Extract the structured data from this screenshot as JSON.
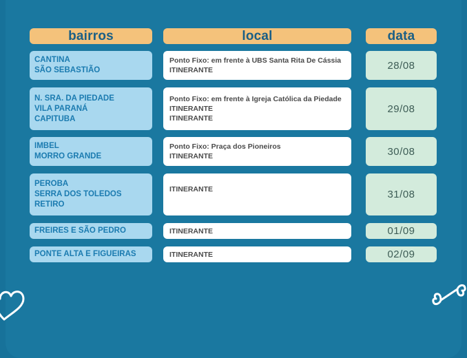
{
  "headers": {
    "bairros": "bairros",
    "local": "local",
    "data": "data"
  },
  "rows": [
    {
      "bairros": [
        "CANTINA",
        "SÃO SEBASTIÃO"
      ],
      "local": [
        "Ponto Fixo: em frente à UBS Santa Rita De Cássia",
        "ITINERANTE"
      ],
      "data": "28/08"
    },
    {
      "bairros": [
        "N. SRA. DA PIEDADE",
        "VILA PARANÁ",
        "CAPITUBA"
      ],
      "local": [
        "Ponto Fixo: em frente à Igreja Católica da Piedade",
        "ITINERANTE",
        "ITINERANTE"
      ],
      "data": "29/08"
    },
    {
      "bairros": [
        "IMBEL",
        "MORRO GRANDE"
      ],
      "local": [
        "Ponto Fixo: Praça dos Pioneiros",
        "ITINERANTE"
      ],
      "data": "30/08"
    },
    {
      "bairros": [
        "PEROBA",
        "SERRA DOS TOLEDOS",
        "RETIRO"
      ],
      "local": [
        "ITINERANTE"
      ],
      "data": "31/08"
    },
    {
      "bairros": [
        "FREIRES E SÃO PEDRO"
      ],
      "local": [
        "ITINERANTE"
      ],
      "data": "01/09"
    },
    {
      "bairros": [
        "PONTE ALTA E FIGUEIRAS"
      ],
      "local": [
        "ITINERANTE"
      ],
      "data": "02/09"
    }
  ],
  "icons": {
    "left": "heart-icon",
    "right": "bone-icon"
  },
  "colors": {
    "background": "#17729a",
    "header": "#f4c27b",
    "bairro_cell": "#a9d8ef",
    "local_cell": "#ffffff",
    "data_cell": "#d3ebdc"
  }
}
